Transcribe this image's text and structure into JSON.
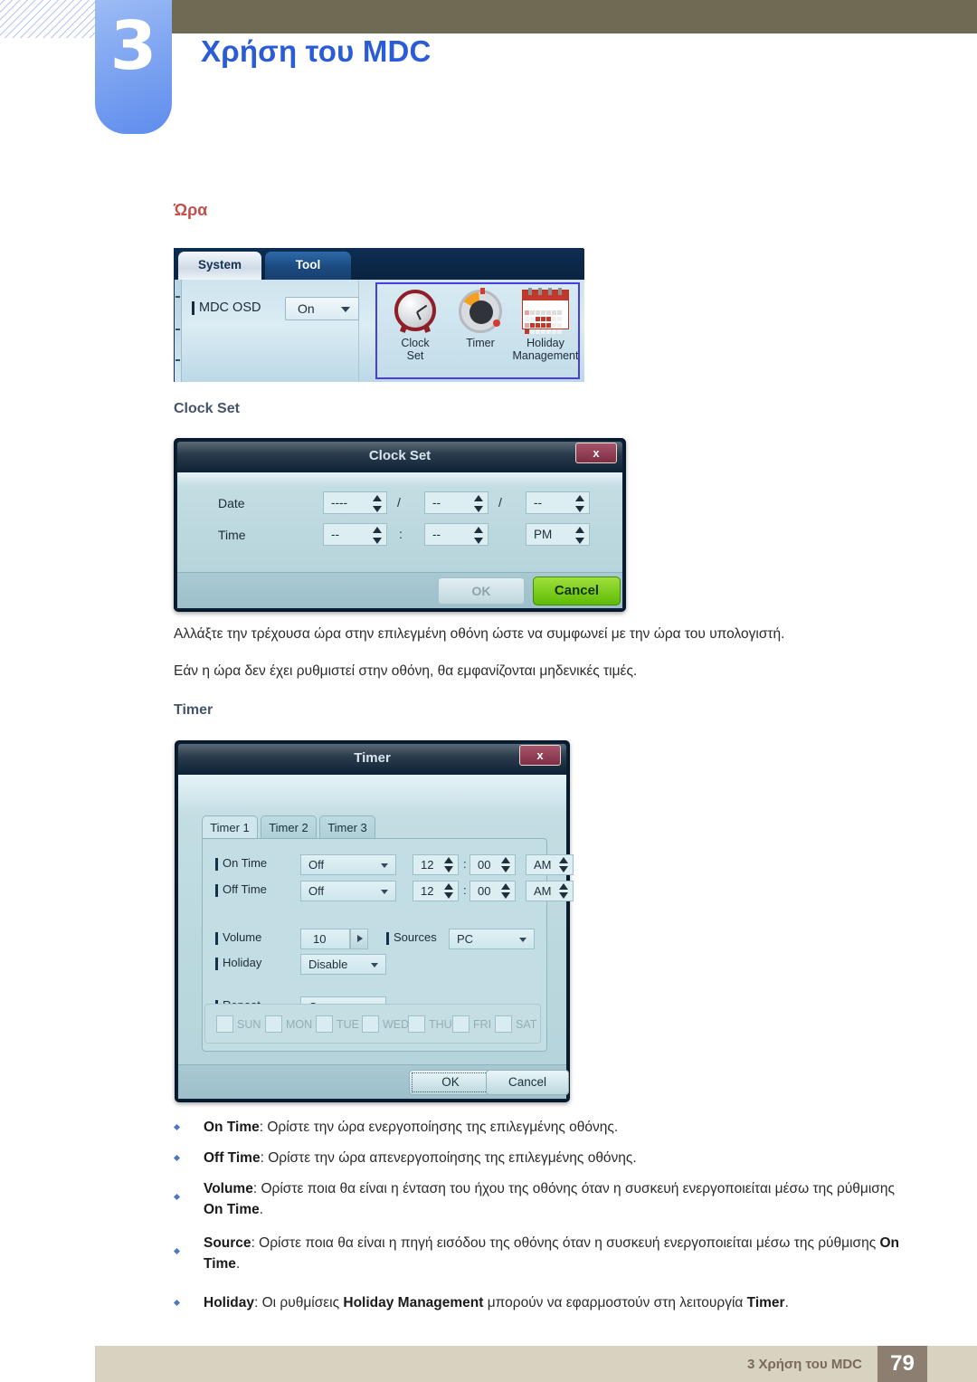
{
  "header": {
    "chapter_number": "3",
    "chapter_title": "Χρήση του MDC"
  },
  "section": {
    "heading": "Ώρα",
    "clock_set_heading": "Clock Set",
    "timer_heading": "Timer",
    "paragraph_1": "Αλλάξτε την τρέχουσα ώρα στην επιλεγμένη οθόνη ώστε να συμφωνεί με την ώρα του υπολογιστή.",
    "paragraph_2": "Εάν η ώρα δεν έχει ρυθμιστεί στην οθόνη, θα εμφανίζονται μηδενικές τιμές."
  },
  "toolbar": {
    "tabs": [
      {
        "label": "System",
        "active": true
      },
      {
        "label": "Tool",
        "active": false
      }
    ],
    "osd": {
      "label": "MDC OSD",
      "value": "On"
    },
    "icons": [
      {
        "name": "clock-set-icon",
        "label_line1": "Clock",
        "label_line2": "Set"
      },
      {
        "name": "timer-icon",
        "label_line1": "Timer",
        "label_line2": ""
      },
      {
        "name": "holiday-management-icon",
        "label_line1": "Holiday",
        "label_line2": "Management"
      }
    ],
    "selection_color": "#4a3ce0"
  },
  "clock_set_dialog": {
    "title": "Clock Set",
    "close_label": "x",
    "date_label": "Date",
    "time_label": "Time",
    "date_year": "----",
    "date_month": "--",
    "date_day": "--",
    "separator": "/",
    "time_hour": "--",
    "time_minute": "--",
    "time_meridiem": "PM",
    "time_separator": ":",
    "ok_label": "OK",
    "cancel_label": "Cancel"
  },
  "timer_dialog": {
    "title": "Timer",
    "close_label": "x",
    "tabs": [
      {
        "label": "Timer 1",
        "active": true
      },
      {
        "label": "Timer 2",
        "active": false
      },
      {
        "label": "Timer 3",
        "active": false
      }
    ],
    "on_time": {
      "label": "On Time",
      "mode": "Off",
      "hour": "12",
      "minute": "00",
      "meridiem": "AM",
      "separator": ":"
    },
    "off_time": {
      "label": "Off Time",
      "mode": "Off",
      "hour": "12",
      "minute": "00",
      "meridiem": "AM",
      "separator": ":"
    },
    "volume": {
      "label": "Volume",
      "value": "10"
    },
    "sources": {
      "label": "Sources",
      "value": "PC"
    },
    "holiday": {
      "label": "Holiday",
      "value": "Disable"
    },
    "repeat": {
      "label": "Repeat",
      "value": "Once"
    },
    "days": [
      {
        "label": "SUN",
        "checked": false
      },
      {
        "label": "MON",
        "checked": false
      },
      {
        "label": "TUE",
        "checked": false
      },
      {
        "label": "WED",
        "checked": false
      },
      {
        "label": "THU",
        "checked": false
      },
      {
        "label": "FRI",
        "checked": false
      },
      {
        "label": "SAT",
        "checked": false
      }
    ],
    "ok_label": "OK",
    "cancel_label": "Cancel"
  },
  "bullets": [
    {
      "term": "On Time",
      "rest": ": Ορίστε την ώρα ενεργοποίησης της επιλεγμένης οθόνης."
    },
    {
      "term": "Off Time",
      "rest": ": Ορίστε την ώρα απενεργοποίησης της επιλεγμένης οθόνης."
    },
    {
      "term": "Volume",
      "rest": ": Ορίστε ποια θα είναι η ένταση του ήχου της οθόνης όταν η συσκευή ενεργοποιείται μέσω της ρύθμισης ",
      "tail_bold": "On Time",
      "tail": "."
    },
    {
      "term": "Source",
      "rest": ": Ορίστε ποια θα είναι η πηγή εισόδου της οθόνης όταν η συσκευή ενεργοποιείται μέσω της ρύθμισης ",
      "tail_bold": "On Time",
      "tail": "."
    },
    {
      "term": "Holiday",
      "rest": ": Οι ρυθμίσεις ",
      "mid_bold": "Holiday Management",
      "mid": " μπορούν να εφαρμοστούν στη λειτουργία ",
      "tail_bold": "Timer",
      "tail": "."
    }
  ],
  "footer": {
    "text": "3 Χρήση του MDC",
    "page": "79"
  }
}
